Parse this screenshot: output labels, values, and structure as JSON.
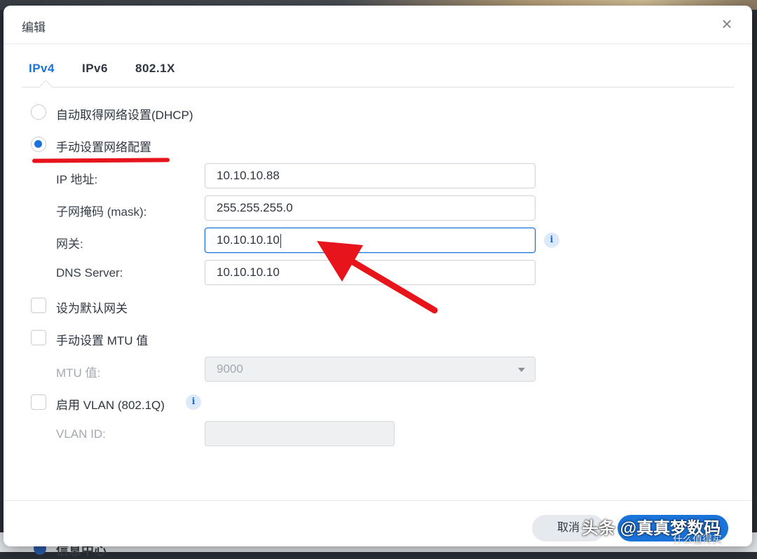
{
  "dialog": {
    "title": "编辑",
    "close_glyph": "×"
  },
  "tabs": [
    {
      "label": "IPv4",
      "active": true
    },
    {
      "label": "IPv6",
      "active": false
    },
    {
      "label": "802.1X",
      "active": false
    }
  ],
  "options": {
    "dhcp_label": "自动取得网络设置(DHCP)",
    "dhcp_checked": false,
    "manual_label": "手动设置网络配置",
    "manual_checked": true
  },
  "fields": {
    "ip": {
      "label": "IP 地址:",
      "value": "10.10.10.88"
    },
    "mask": {
      "label": "子网掩码 (mask):",
      "value": "255.255.255.0"
    },
    "gateway": {
      "label": "网关:",
      "value": "10.10.10.10",
      "info_glyph": "i"
    },
    "dns": {
      "label": "DNS Server:",
      "value": "10.10.10.10"
    }
  },
  "checkboxes": {
    "default_gateway": {
      "label": "设为默认网关",
      "checked": false
    },
    "manual_mtu": {
      "label": "手动设置 MTU 值",
      "checked": false
    },
    "vlan": {
      "label": "启用 VLAN (802.1Q)",
      "checked": false,
      "info_glyph": "i"
    }
  },
  "mtu": {
    "label": "MTU 值:",
    "value": "9000"
  },
  "vlan_id": {
    "label": "VLAN ID:",
    "value": ""
  },
  "footer": {
    "cancel_label": "取消",
    "ok_label": ""
  },
  "background": {
    "app_label": "信息中心"
  },
  "watermark": {
    "text": "头条 @真真梦数码",
    "small_text": "什么值得买"
  },
  "colors": {
    "accent": "#1a73d9",
    "annotation_red": "#e8141c"
  }
}
